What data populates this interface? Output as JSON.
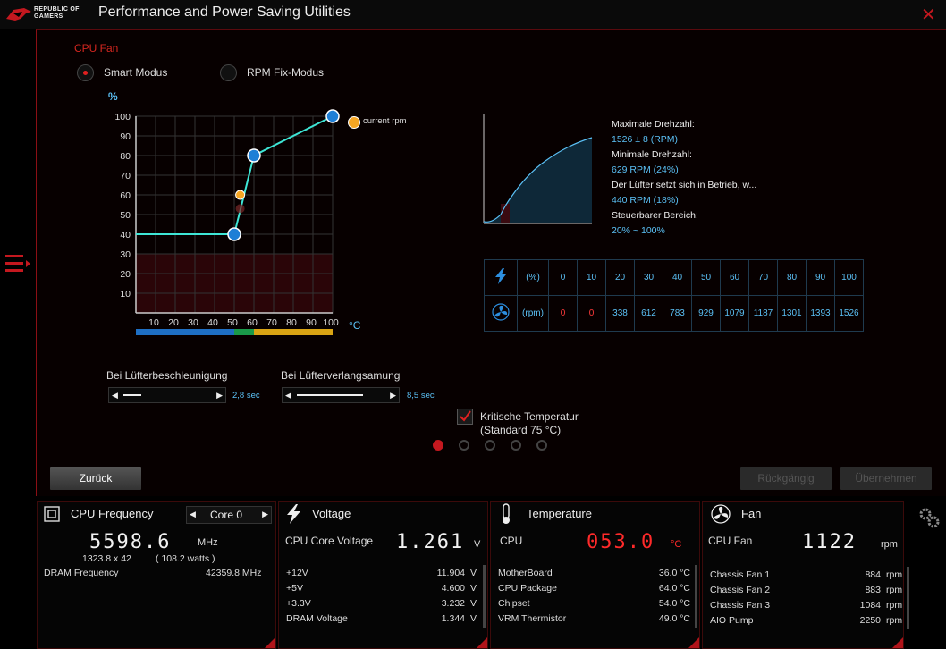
{
  "app": {
    "title": "Performance and Power Saving Utilities",
    "logo_line1": "REPUBLIC OF",
    "logo_line2": "GAMERS"
  },
  "fan_section": {
    "label": "CPU Fan",
    "mode_smart": "Smart Modus",
    "mode_rpm": "RPM Fix-Modus",
    "selected_mode": "Smart Modus",
    "legend_current": "current rpm",
    "y_unit": "%",
    "x_unit": "°C"
  },
  "chart_data": {
    "type": "line",
    "ylabel": "%",
    "xlabel": "°C",
    "x_ticks": [
      10,
      20,
      30,
      40,
      50,
      60,
      70,
      80,
      90,
      100
    ],
    "y_ticks": [
      10,
      20,
      30,
      40,
      50,
      60,
      70,
      80,
      90,
      100
    ],
    "xlim": [
      0,
      100
    ],
    "ylim": [
      0,
      100
    ],
    "curve_points": [
      {
        "x": 0,
        "y": 40
      },
      {
        "x": 50,
        "y": 40
      },
      {
        "x": 60,
        "y": 80
      },
      {
        "x": 100,
        "y": 100
      }
    ],
    "current_rpm_point": {
      "x": 53,
      "y": 60
    },
    "grid": true
  },
  "rpm_info": {
    "max_label": "Maximale Drehzahl:",
    "max_value": "1526 ± 8 (RPM)",
    "min_label": "Minimale Drehzahl:",
    "min_value": "629 RPM (24%)",
    "start_label": "Der Lüfter setzt sich in Betrieb, w...",
    "start_value": "440 RPM (18%)",
    "range_label": "Steuerbarer Bereich:",
    "range_value": "20% ~ 100%"
  },
  "rpm_table": {
    "pct_unit": "(%)",
    "rpm_unit": "(rpm)",
    "percent": [
      "0",
      "10",
      "20",
      "30",
      "40",
      "50",
      "60",
      "70",
      "80",
      "90",
      "100"
    ],
    "rpm": [
      "0",
      "0",
      "338",
      "612",
      "783",
      "929",
      "1079",
      "1187",
      "1301",
      "1393",
      "1526"
    ]
  },
  "sliders": {
    "accel_label": "Bei Lüfterbeschleunigung",
    "accel_value": "2,8 sec",
    "accel_fraction": 0.2,
    "decel_label": "Bei Lüfterverlangsamung",
    "decel_value": "8,5 sec",
    "decel_fraction": 0.75
  },
  "critical": {
    "line1": "Kritische Temperatur",
    "line2": "(Standard 75 °C)",
    "checked": true
  },
  "buttons": {
    "back": "Zurück",
    "undo": "Rückgängig",
    "apply": "Übernehmen"
  },
  "cpu_freq": {
    "title": "CPU Frequency",
    "core_select": "Core 0",
    "value": "5598.6",
    "unit": "MHz",
    "multiplier": "1323.8   x  42",
    "watts": "( 108.2 watts )",
    "dram_label": "DRAM Frequency",
    "dram_value": "42359.8  MHz"
  },
  "voltage": {
    "title": "Voltage",
    "main_label": "CPU Core Voltage",
    "main_value": "1.261",
    "main_unit": "V",
    "rows": [
      {
        "label": "+12V",
        "value": "11.904",
        "unit": "V"
      },
      {
        "label": "+5V",
        "value": "4.600",
        "unit": "V"
      },
      {
        "label": "+3.3V",
        "value": "3.232",
        "unit": "V"
      },
      {
        "label": "DRAM Voltage",
        "value": "1.344",
        "unit": "V"
      }
    ]
  },
  "temperature": {
    "title": "Temperature",
    "main_label": "CPU",
    "main_value": "053.0",
    "main_unit": "°C",
    "rows": [
      {
        "label": "MotherBoard",
        "value": "36.0 °C"
      },
      {
        "label": "CPU Package",
        "value": "64.0 °C"
      },
      {
        "label": "Chipset",
        "value": "54.0 °C"
      },
      {
        "label": "VRM Thermistor",
        "value": "49.0 °C"
      }
    ]
  },
  "fan": {
    "title": "Fan",
    "main_label": "CPU Fan",
    "main_value": "1122",
    "main_unit": "rpm",
    "rows": [
      {
        "label": "Chassis Fan 1",
        "value": "884",
        "unit": "rpm"
      },
      {
        "label": "Chassis Fan 2",
        "value": "883",
        "unit": "rpm"
      },
      {
        "label": "Chassis Fan 3",
        "value": "1084",
        "unit": "rpm"
      },
      {
        "label": "AIO Pump",
        "value": "2250",
        "unit": "rpm"
      }
    ]
  },
  "colors": {
    "accent_red": "#c4181f",
    "curve": "#3ee6d6",
    "info_blue": "#5bc0f5"
  }
}
